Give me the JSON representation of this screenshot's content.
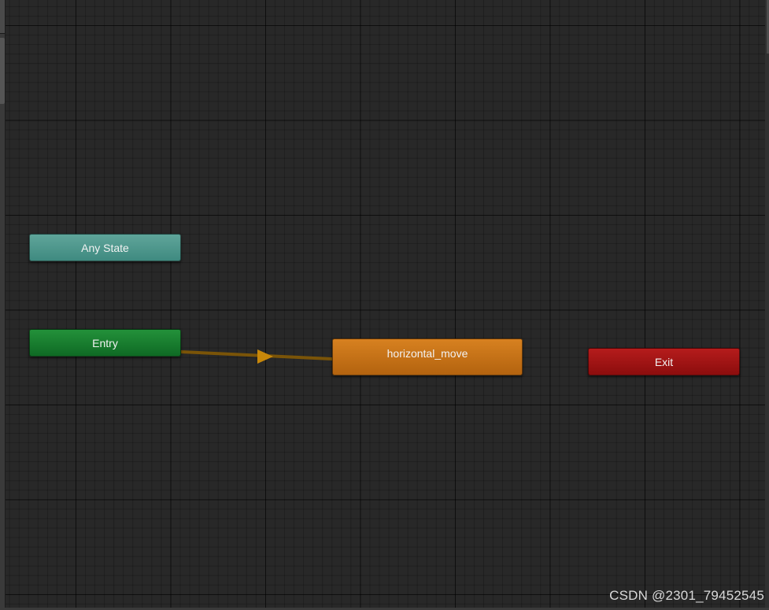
{
  "graph": {
    "nodes": {
      "any_state": {
        "label": "Any State",
        "color": "#4f998f"
      },
      "entry": {
        "label": "Entry",
        "color": "#1a7f30"
      },
      "default_state": {
        "label": "horizontal_move",
        "color": "#c97217"
      },
      "exit": {
        "label": "Exit",
        "color": "#a01515"
      }
    },
    "transitions": [
      {
        "from": "Entry",
        "to": "horizontal_move",
        "color": "#7a5408",
        "arrow_color": "#c7870a"
      }
    ]
  },
  "watermark": "CSDN @2301_79452545"
}
